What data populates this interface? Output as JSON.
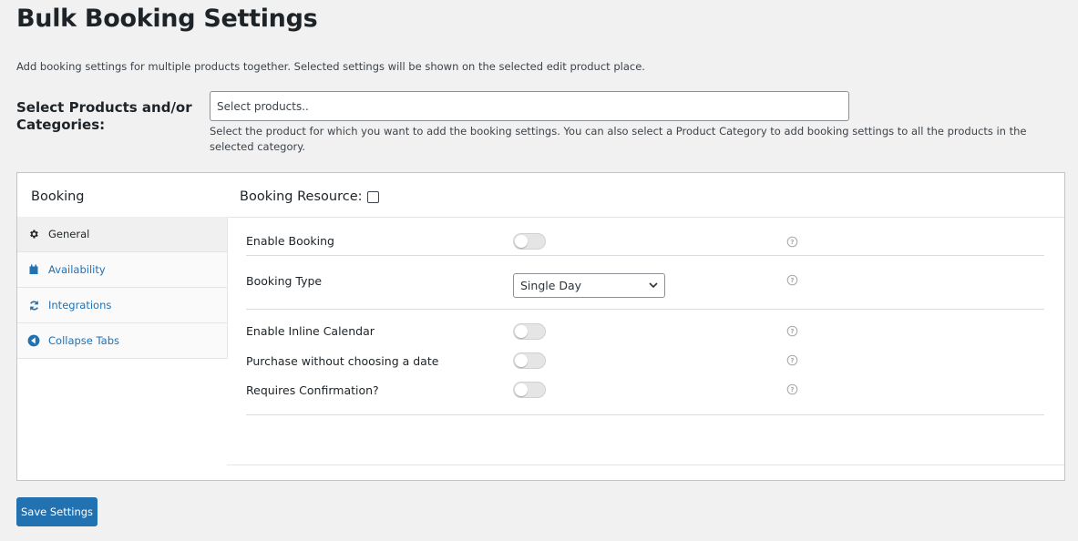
{
  "page": {
    "title": "Bulk Booking Settings",
    "description": "Add booking settings for multiple products together. Selected settings will be shown on the selected edit product place."
  },
  "product_select": {
    "label": "Select Products and/or Categories:",
    "placeholder": "Select products..",
    "help": "Select the product for which you want to add the booking settings. You can also select a Product Category to add booking settings to all the products in the selected category."
  },
  "sidebar": {
    "title": "Booking",
    "items": [
      {
        "label": "General",
        "icon": "gear-icon",
        "active": true
      },
      {
        "label": "Availability",
        "icon": "calendar-icon",
        "active": false
      },
      {
        "label": "Integrations",
        "icon": "sync-icon",
        "active": false
      },
      {
        "label": "Collapse Tabs",
        "icon": "collapse-arrow-icon",
        "active": false
      }
    ]
  },
  "booking_resource": {
    "label": "Booking Resource:",
    "checked": false
  },
  "settings": {
    "enable_booking": {
      "label": "Enable Booking",
      "on": false
    },
    "booking_type": {
      "label": "Booking Type",
      "value": "Single Day"
    },
    "enable_inline_calendar": {
      "label": "Enable Inline Calendar",
      "on": false
    },
    "purchase_without_date": {
      "label": "Purchase without choosing a date",
      "on": false
    },
    "requires_confirmation": {
      "label": "Requires Confirmation?",
      "on": false
    }
  },
  "actions": {
    "save_label": "Save Settings"
  },
  "colors": {
    "accent": "#2271b1",
    "toggle_off": "#e5e5e5",
    "active_tab_bg": "#f0f0f1"
  }
}
